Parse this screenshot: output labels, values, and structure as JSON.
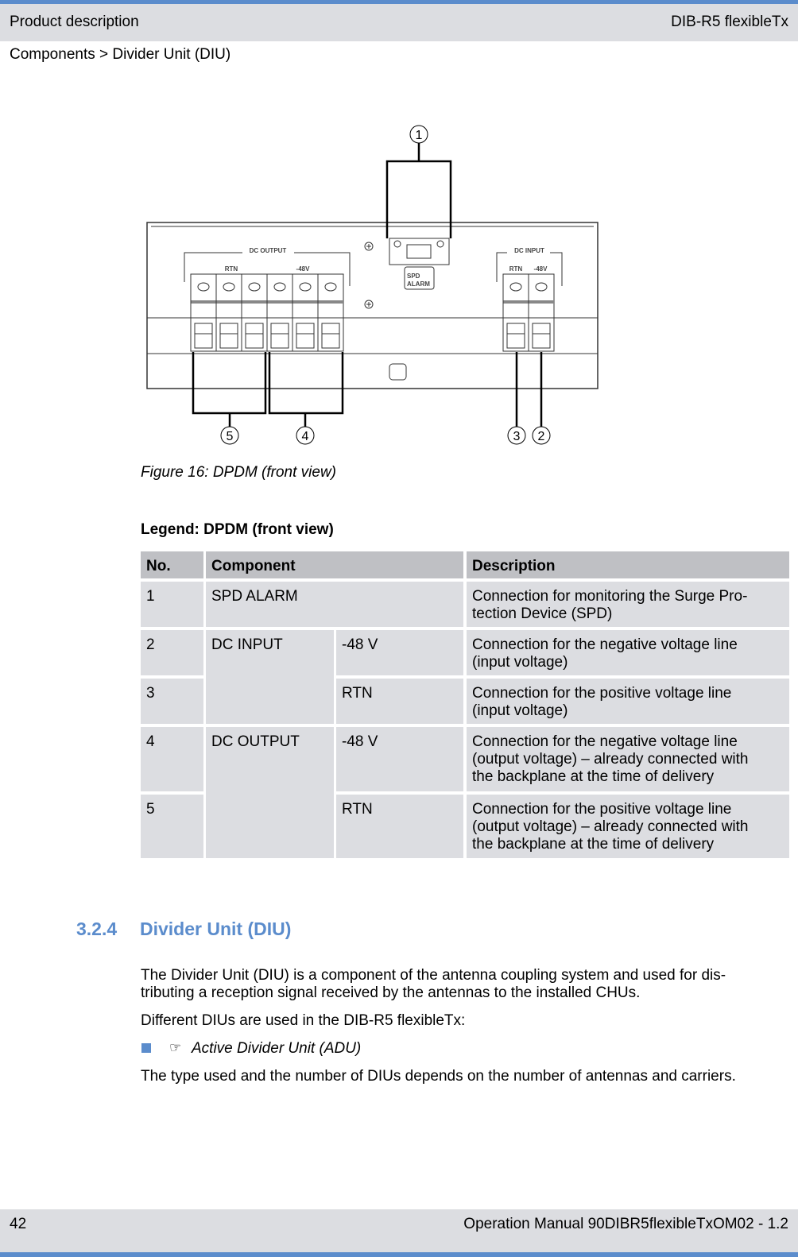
{
  "header": {
    "left": "Product description",
    "right": "DIB-R5 flexibleTx"
  },
  "breadcrumb": "Components > Divider Unit (DIU)",
  "figure": {
    "labels": {
      "dc_output": "DC OUTPUT",
      "dc_input": "DC INPUT",
      "rtn": "RTN",
      "minus48": "-48V",
      "spd": "SPD",
      "alarm": "ALARM"
    },
    "callouts": [
      "1",
      "2",
      "3",
      "4",
      "5"
    ],
    "caption": "Figure 16: DPDM (front view)"
  },
  "legend_title": "Legend: DPDM (front view)",
  "table": {
    "headers": [
      "No.",
      "Component",
      "Description"
    ],
    "rows": [
      {
        "no": "1",
        "component": "SPD ALARM",
        "sub": "",
        "desc": "Connection for monitoring the Surge Pro-\ntection Device (SPD)"
      },
      {
        "no": "2",
        "component": "DC INPUT",
        "sub": "-48 V",
        "desc": "Connection for the negative voltage line\n(input voltage)"
      },
      {
        "no": "3",
        "component": "",
        "sub": "RTN",
        "desc": "Connection for the positive voltage line\n(input voltage)"
      },
      {
        "no": "4",
        "component": "DC OUTPUT",
        "sub": "-48 V",
        "desc": "Connection for the negative voltage line\n(output voltage) – already connected with\nthe backplane at the time of delivery"
      },
      {
        "no": "5",
        "component": "",
        "sub": "RTN",
        "desc": "Connection for the positive voltage line\n(output voltage) – already connected with\nthe backplane at the time of delivery"
      }
    ]
  },
  "section": {
    "number": "3.2.4",
    "title": "Divider Unit (DIU)",
    "para1": "The Divider Unit (DIU) is a component of the antenna coupling system and used for dis-\ntributing a reception signal received by the antennas to the installed CHUs.",
    "para2": "Different DIUs are used in the DIB-R5 flexibleTx:",
    "bullet_icon": "hand-pointer-icon",
    "bullet": "Active Divider Unit (ADU)",
    "para3": "The type used and the number of DIUs depends on the number of antennas and carriers."
  },
  "footer": {
    "page": "42",
    "doc": "Operation Manual 90DIBR5flexibleTxOM02 - 1.2"
  },
  "colors": {
    "accent": "#5b8ccc",
    "header_bg": "#dcdde1",
    "table_header": "#bfc0c4"
  }
}
